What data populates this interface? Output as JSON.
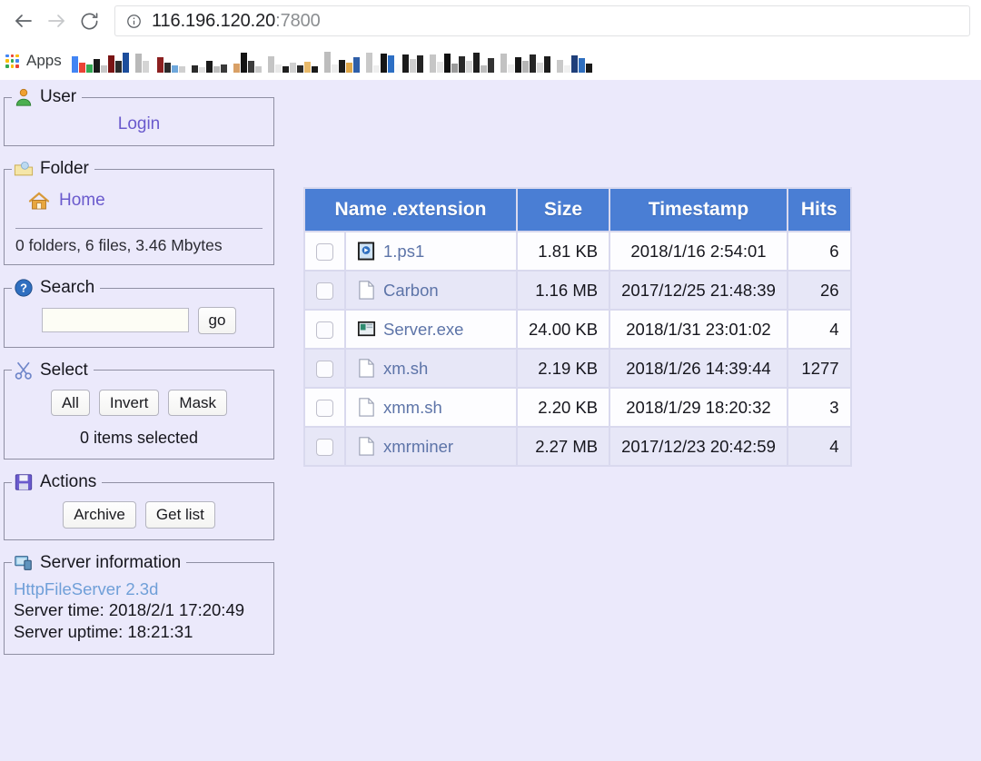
{
  "browser": {
    "back_icon": "arrow-left-icon",
    "forward_icon": "arrow-right-icon",
    "reload_icon": "reload-icon",
    "info_icon": "info-circle-icon",
    "url_host": "116.196.120.20",
    "url_port": ":7800",
    "apps_label": "Apps",
    "bookmarks": [
      {
        "name": "bookmark-1"
      },
      {
        "name": "bookmark-2"
      },
      {
        "name": "bookmark-3"
      },
      {
        "name": "bookmark-4"
      },
      {
        "name": "bookmark-5"
      },
      {
        "name": "bookmark-6"
      },
      {
        "name": "bookmark-7"
      },
      {
        "name": "bookmark-8"
      },
      {
        "name": "bookmark-9"
      },
      {
        "name": "bookmark-10"
      }
    ]
  },
  "sidebar": {
    "user": {
      "legend": "User",
      "icon": "user-icon",
      "login_label": "Login"
    },
    "folder": {
      "legend": "Folder",
      "icon": "folder-icon",
      "home_label": "Home",
      "home_icon": "home-icon",
      "stats": "0 folders, 6 files, 3.46 Mbytes"
    },
    "search": {
      "legend": "Search",
      "icon": "help-icon",
      "value": "",
      "placeholder": "",
      "go_label": "go"
    },
    "select": {
      "legend": "Select",
      "icon": "scissors-icon",
      "buttons": [
        "All",
        "Invert",
        "Mask"
      ],
      "status": "0 items selected"
    },
    "actions": {
      "legend": "Actions",
      "icon": "save-icon",
      "buttons": [
        "Archive",
        "Get list"
      ]
    },
    "server_information": {
      "legend": "Server information",
      "icon": "server-icon",
      "product": "HttpFileServer 2.3d",
      "server_time": "Server time: 2018/2/1 17:20:49",
      "server_uptime": "Server uptime: 18:21:31"
    }
  },
  "file_table": {
    "columns": [
      "Name .extension",
      "Size",
      "Timestamp",
      "Hits"
    ],
    "rows": [
      {
        "name": "1.ps1",
        "icon": "image-file-icon",
        "size": "1.81 KB",
        "timestamp": "2018/1/16 2:54:01",
        "hits": "6"
      },
      {
        "name": "Carbon",
        "icon": "blank-file-icon",
        "size": "1.16 MB",
        "timestamp": "2017/12/25 21:48:39",
        "hits": "26"
      },
      {
        "name": "Server.exe",
        "icon": "exe-file-icon",
        "size": "24.00 KB",
        "timestamp": "2018/1/31 23:01:02",
        "hits": "4"
      },
      {
        "name": "xm.sh",
        "icon": "blank-file-icon",
        "size": "2.19 KB",
        "timestamp": "2018/1/26 14:39:44",
        "hits": "1277"
      },
      {
        "name": "xmm.sh",
        "icon": "blank-file-icon",
        "size": "2.20 KB",
        "timestamp": "2018/1/29 18:20:32",
        "hits": "3"
      },
      {
        "name": "xmrminer",
        "icon": "blank-file-icon",
        "size": "2.27 MB",
        "timestamp": "2017/12/23 20:42:59",
        "hits": "4"
      }
    ]
  },
  "colors": {
    "page_background": "#ebe9fb",
    "table_header": "#4a7ed4",
    "link": "#6a5acd",
    "file_link": "#5d74a8",
    "row_alt": "#e7e7f7"
  }
}
